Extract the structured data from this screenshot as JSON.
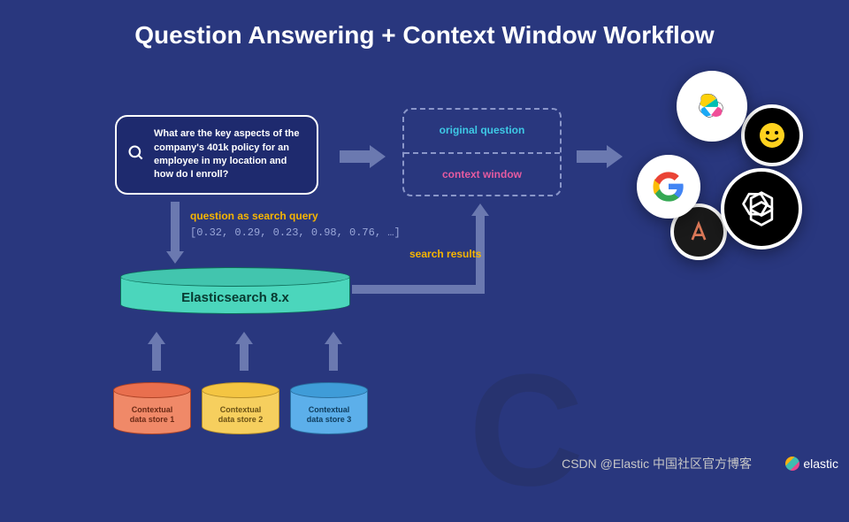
{
  "title": "Question Answering + Context Window Workflow",
  "question_box": {
    "text": "What are the key aspects of the company's 401k policy for an employee in my location and how do I enroll?"
  },
  "query": {
    "label": "question as search query",
    "vector": "[0.32, 0.29, 0.23, 0.98, 0.76, …]"
  },
  "elasticsearch": {
    "label": "Elasticsearch 8.x"
  },
  "data_stores": [
    {
      "label": "Contextual\ndata store 1"
    },
    {
      "label": "Contextual\ndata store 2"
    },
    {
      "label": "Contextual\ndata store 3"
    }
  ],
  "context_box": {
    "top": "original question",
    "bottom": "context window"
  },
  "search_results_label": "search results",
  "llm_icons": [
    "elastic",
    "huggingface",
    "google",
    "openai",
    "anthropic"
  ],
  "attribution": "CSDN @Elastic 中国社区官方博客",
  "footer_brand": "elastic"
}
